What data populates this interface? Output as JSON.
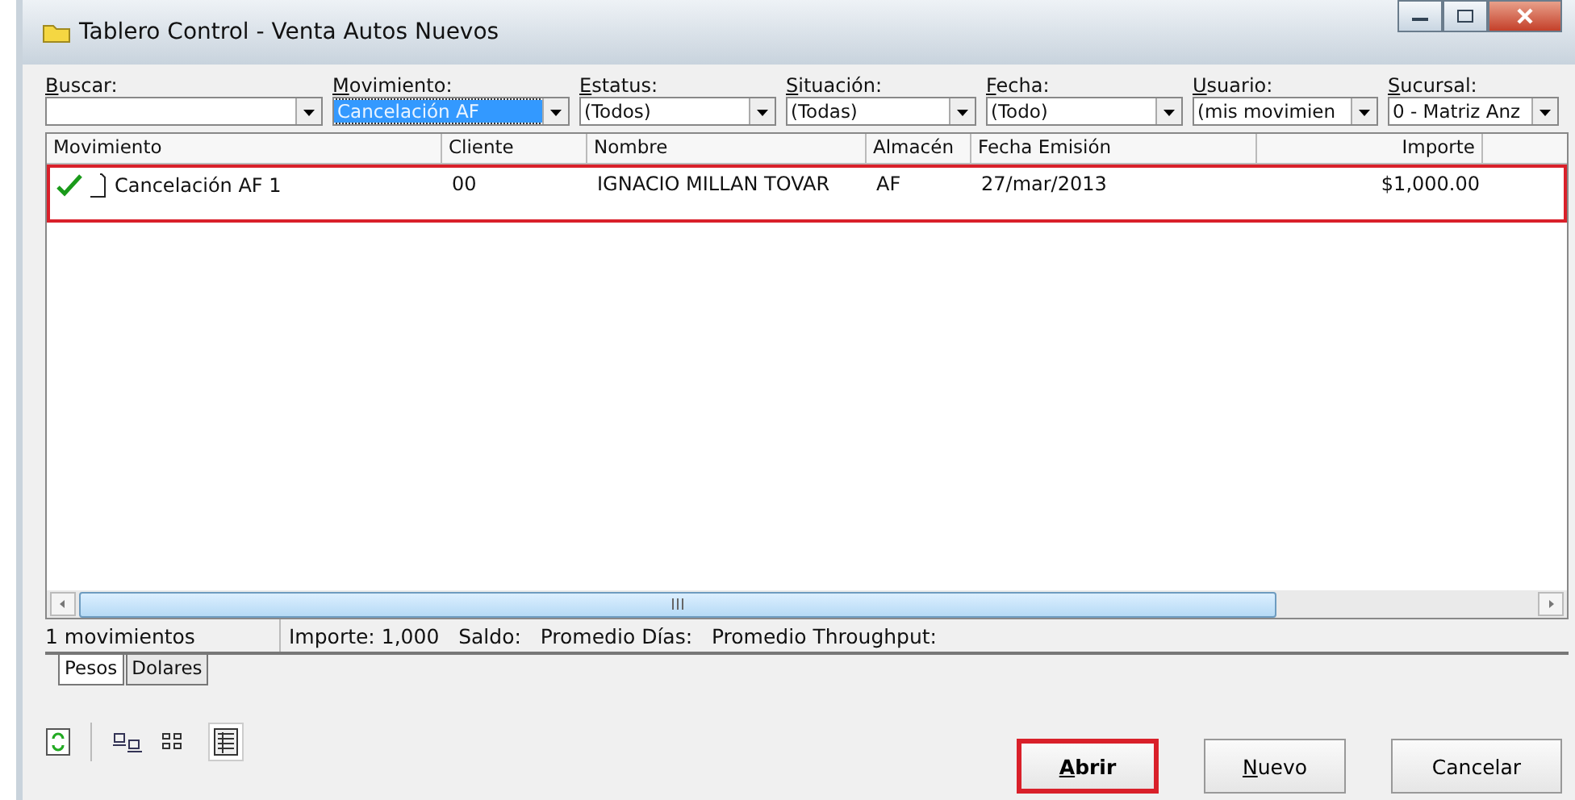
{
  "window": {
    "title": "Tablero Control - Venta Autos Nuevos"
  },
  "filters": [
    {
      "label": "Buscar:",
      "focused": false
    },
    {
      "label": "Movimiento:",
      "value": "Cancelación AF",
      "focused": true
    },
    {
      "label": "Estatus:",
      "value": "(Todos)",
      "focused": false
    },
    {
      "label": "Situación:",
      "value": "(Todas)",
      "focused": false
    },
    {
      "label": "Fecha:",
      "value": "(Todo)",
      "focused": false
    },
    {
      "label": "Usuario:",
      "value": "(mis movimien",
      "focused": false
    },
    {
      "label": "Sucursal:",
      "value": "0 - Matriz Anz",
      "focused": false
    }
  ],
  "table": {
    "columns": [
      "Movimiento",
      "Cliente",
      "Nombre",
      "Almacén",
      "Fecha Emisión",
      "Importe"
    ],
    "rows": [
      {
        "checked": true,
        "highlighted": true,
        "cells": [
          "Cancelación AF 1",
          "00",
          "IGNACIO MILLAN TOVAR",
          "AF",
          "27/mar/2013",
          "$1,000.00"
        ]
      }
    ]
  },
  "status_bar": {
    "count": "1 movimientos",
    "summary": "Importe: 1,000   Saldo:   Promedio Días:   Promedio Throughput:"
  },
  "tabs": [
    {
      "label": "Pesos",
      "selected": true
    },
    {
      "label": "Dolares",
      "selected": false
    }
  ],
  "buttons": [
    {
      "label": "Abrir",
      "bold": true,
      "accel": true,
      "highlighted": true
    },
    {
      "label": "Nuevo",
      "bold": false,
      "accel": true,
      "highlighted": false
    },
    {
      "label": "Cancelar",
      "bold": false,
      "accel": false,
      "highlighted": false
    }
  ]
}
